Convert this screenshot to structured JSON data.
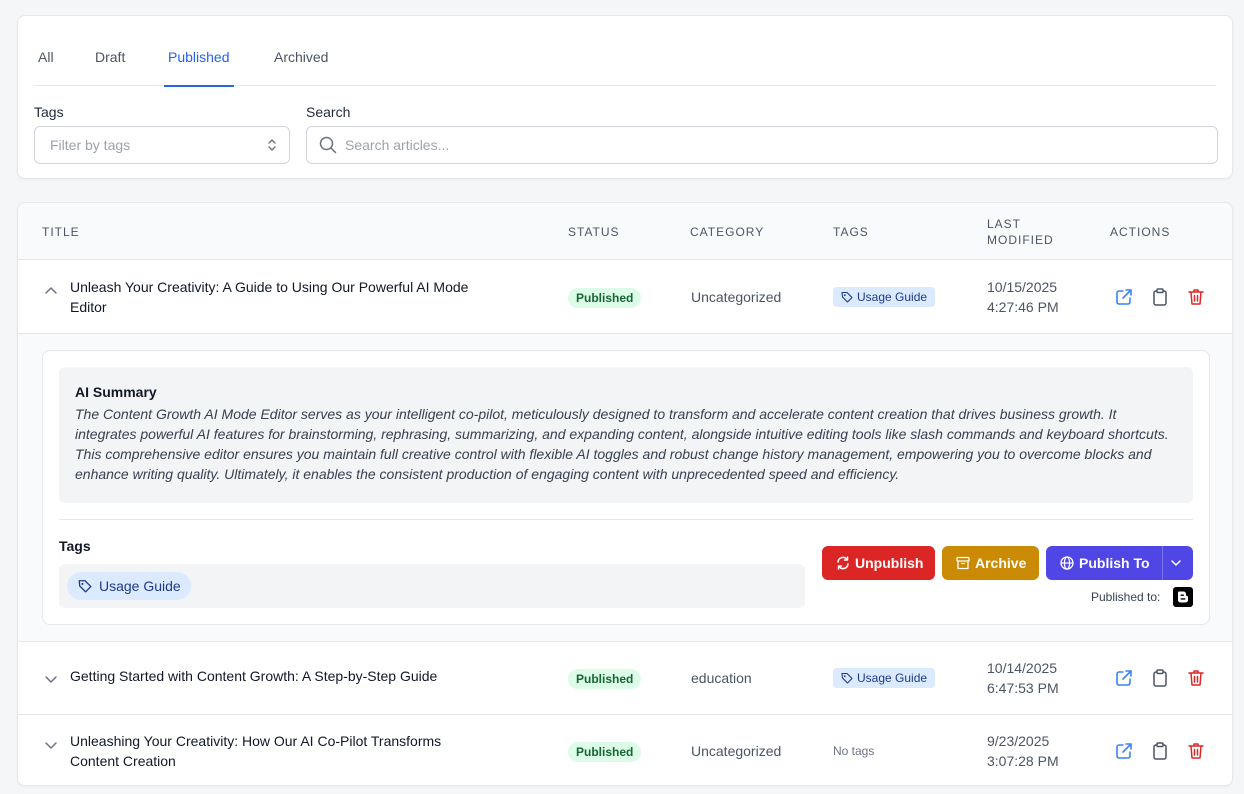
{
  "tabs": [
    {
      "label": "All",
      "active": false
    },
    {
      "label": "Draft",
      "active": false
    },
    {
      "label": "Published",
      "active": true
    },
    {
      "label": "Archived",
      "active": false
    }
  ],
  "filters": {
    "tags_label": "Tags",
    "tags_placeholder": "Filter by tags",
    "search_label": "Search",
    "search_placeholder": "Search articles..."
  },
  "table": {
    "headers": {
      "title": "TITLE",
      "status": "STATUS",
      "category": "CATEGORY",
      "tags": "TAGS",
      "last_modified_1": "LAST",
      "last_modified_2": "MODIFIED",
      "actions": "ACTIONS"
    },
    "rows": [
      {
        "title_line1": "Unleash Your Creativity: A Guide to Using Our Powerful AI Mode",
        "title_line2": "Editor",
        "status": "Published",
        "category": "Uncategorized",
        "tag": "Usage Guide",
        "date": "10/15/2025",
        "time": "4:27:46 PM",
        "expanded": true
      },
      {
        "title_line1": "Getting Started with Content Growth: A Step-by-Step Guide",
        "status": "Published",
        "category": "education",
        "tag": "Usage Guide",
        "date": "10/14/2025",
        "time": "6:47:53 PM",
        "expanded": false
      },
      {
        "title_line1": "Unleashing Your Creativity: How Our AI Co-Pilot Transforms",
        "title_line2": "Content Creation",
        "status": "Published",
        "category": "Uncategorized",
        "no_tags": "No tags",
        "date": "9/23/2025",
        "time": "3:07:28 PM",
        "expanded": false
      }
    ]
  },
  "detail": {
    "summary_title": "AI Summary",
    "summary_text": "The Content Growth AI Mode Editor serves as your intelligent co-pilot, meticulously designed to transform and accelerate content creation that drives business growth. It integrates powerful AI features for brainstorming, rephrasing, summarizing, and expanding content, alongside intuitive editing tools like slash commands and keyboard shortcuts. This comprehensive editor ensures you maintain full creative control with flexible AI toggles and robust change history management, empowering you to overcome blocks and enhance writing quality. Ultimately, it enables the consistent production of engaging content with unprecedented speed and efficiency.",
    "tags_label": "Tags",
    "tag": "Usage Guide",
    "unpublish_label": "Unpublish",
    "archive_label": "Archive",
    "publish_to_label": "Publish To",
    "published_to_label": "Published to:",
    "published_platform_icon": "blogger-icon"
  },
  "colors": {
    "accent": "#2563eb",
    "published_badge_bg": "#dcfce7",
    "unpublish": "#dc2626",
    "archive": "#ca8a04",
    "publish_to": "#4f46e5",
    "delete_icon": "#dc2626"
  }
}
